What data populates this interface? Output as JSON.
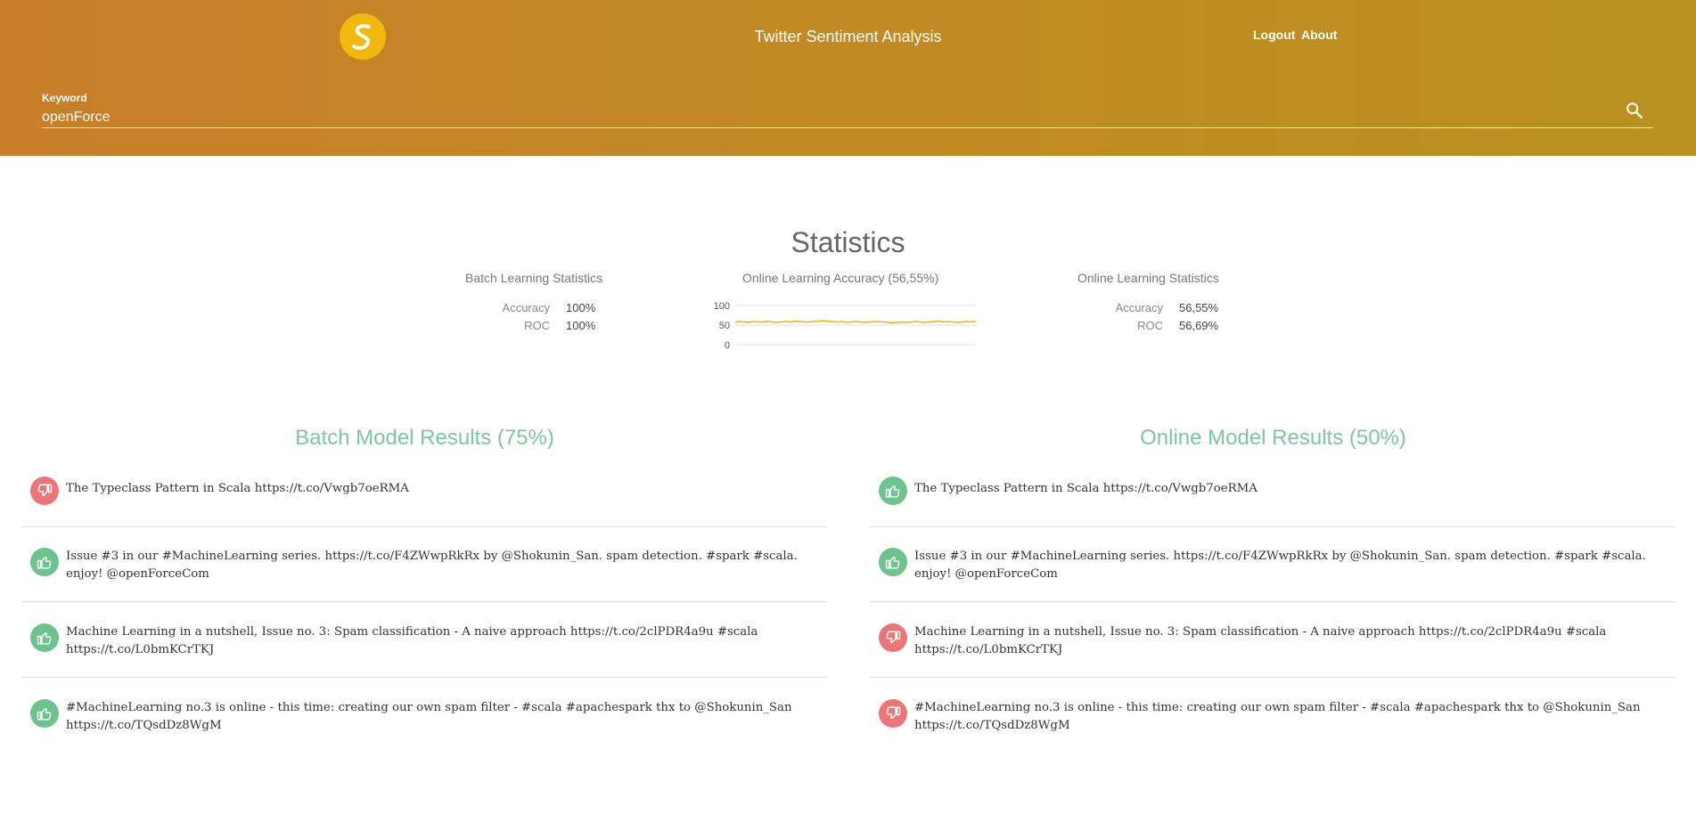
{
  "header": {
    "title": "Twitter Sentiment Analysis",
    "nav": {
      "logout": "Logout",
      "about": "About"
    },
    "keyword_label": "Keyword",
    "keyword_value": "openForce",
    "colors": {
      "gradient_start": "#c97e2a",
      "gradient_end": "#b99120",
      "logo": "#f2b90c"
    }
  },
  "statistics": {
    "title": "Statistics",
    "batch": {
      "heading": "Batch Learning Statistics",
      "accuracy_label": "Accuracy",
      "accuracy_value": "100%",
      "roc_label": "ROC",
      "roc_value": "100%"
    },
    "online": {
      "heading": "Online Learning Statistics",
      "accuracy_label": "Accuracy",
      "accuracy_value": "56,55%",
      "roc_label": "ROC",
      "roc_value": "56,69%"
    },
    "chart_title": "Online Learning Accuracy (56,55%)"
  },
  "chart_data": {
    "type": "line",
    "title": "Online Learning Accuracy (56,55%)",
    "ylim": [
      0,
      100
    ],
    "yticks": [
      "100",
      "50",
      "0"
    ],
    "series": [
      {
        "color": "#f0b400",
        "values": [
          58,
          59,
          58,
          57,
          59,
          58,
          58,
          60,
          58,
          57,
          58,
          59,
          58,
          60,
          59,
          58,
          58,
          59,
          60,
          61,
          60,
          59,
          58,
          59,
          57,
          58,
          59,
          58,
          57,
          58,
          59,
          59,
          58,
          57,
          56,
          57,
          58,
          57,
          58,
          59,
          58,
          57,
          58,
          59,
          60,
          58,
          59,
          58,
          57,
          58,
          59,
          58,
          60
        ]
      }
    ],
    "grid": true
  },
  "results": {
    "batch": {
      "title": "Batch Model Results (75%)",
      "tweets": [
        {
          "sentiment": "negative",
          "icon": "thumbs-down-icon",
          "text": "The Typeclass Pattern in Scala https://t.co/Vwgb7oeRMA"
        },
        {
          "sentiment": "positive",
          "icon": "thumbs-up-icon",
          "text": "Issue #3 in our #MachineLearning series. https://t.co/F4ZWwpRkRx by @Shokunin_San. spam detection. #spark #scala. enjoy! @openForceCom"
        },
        {
          "sentiment": "positive",
          "icon": "thumbs-up-icon",
          "text": "Machine Learning in a nutshell, Issue no. 3: Spam classification - A naive approach https://t.co/2clPDR4a9u #scala https://t.co/L0bmKCrTKJ"
        },
        {
          "sentiment": "positive",
          "icon": "thumbs-up-icon",
          "text": "#MachineLearning no.3 is online - this time: creating our own spam filter - #scala #apachespark thx to @Shokunin_San https://t.co/TQsdDz8WgM"
        }
      ]
    },
    "online": {
      "title": "Online Model Results (50%)",
      "tweets": [
        {
          "sentiment": "positive",
          "icon": "thumbs-up-icon",
          "text": "The Typeclass Pattern in Scala https://t.co/Vwgb7oeRMA"
        },
        {
          "sentiment": "positive",
          "icon": "thumbs-up-icon",
          "text": "Issue #3 in our #MachineLearning series. https://t.co/F4ZWwpRkRx by @Shokunin_San. spam detection. #spark #scala. enjoy! @openForceCom"
        },
        {
          "sentiment": "negative",
          "icon": "thumbs-down-icon",
          "text": "Machine Learning in a nutshell, Issue no. 3: Spam classification - A naive approach https://t.co/2clPDR4a9u #scala https://t.co/L0bmKCrTKJ"
        },
        {
          "sentiment": "negative",
          "icon": "thumbs-down-icon",
          "text": "#MachineLearning no.3 is online - this time: creating our own spam filter - #scala #apachespark thx to @Shokunin_San https://t.co/TQsdDz8WgM"
        }
      ]
    }
  }
}
